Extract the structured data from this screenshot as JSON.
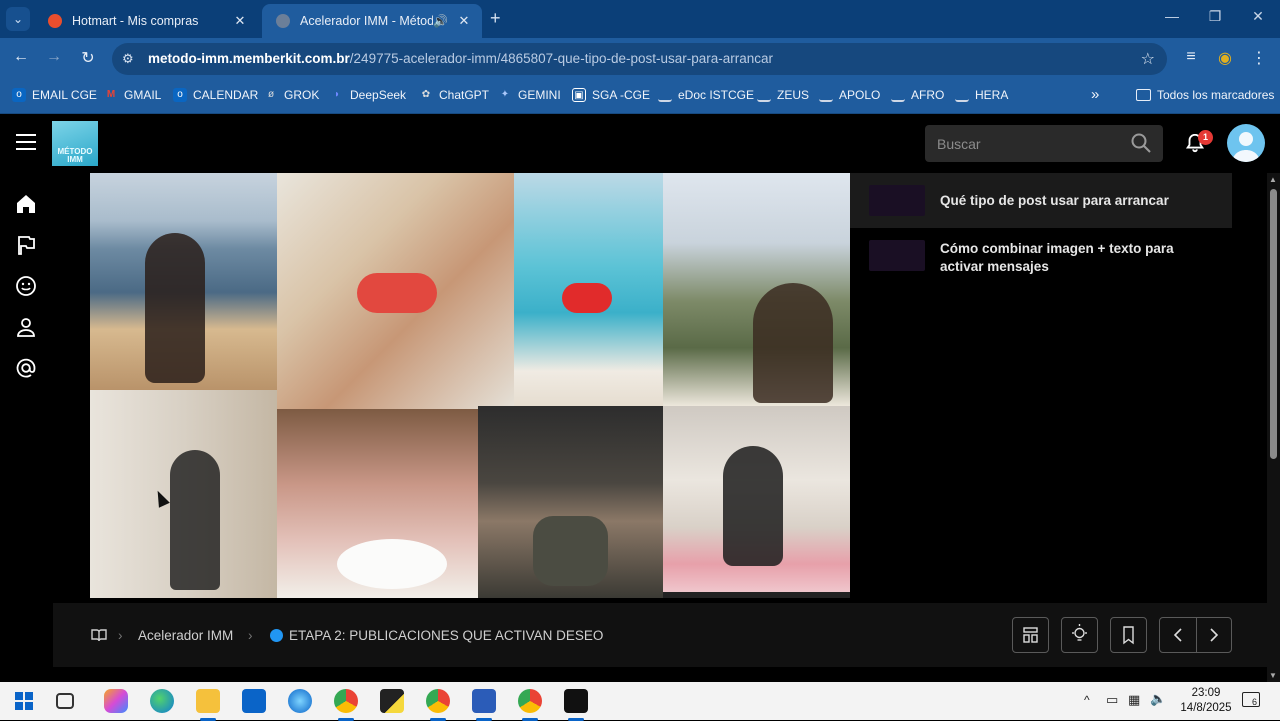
{
  "browser": {
    "tabs": [
      {
        "title": "Hotmart - Mis compras",
        "close": "✕"
      },
      {
        "title": "Acelerador IMM - Método IMM",
        "close": "✕"
      }
    ],
    "new_tab": "+",
    "url_domain": "metodo-imm.memberkit.com.br",
    "url_path": "/249775-acelerador-imm/4865807-que-tipo-de-post-usar-para-arrancar"
  },
  "bookmarks": {
    "items": [
      {
        "label": "EMAIL CGE",
        "color": "#0a66c2"
      },
      {
        "label": "GMAIL",
        "color": "#ea4335"
      },
      {
        "label": "CALENDAR",
        "color": "#0a66c2"
      },
      {
        "label": "GROK",
        "color": "#cccccc"
      },
      {
        "label": "DeepSeek",
        "color": "#4d6bfe"
      },
      {
        "label": "ChatGPT",
        "color": "#cccccc"
      },
      {
        "label": "GEMINI",
        "color": "#8ab4f8"
      },
      {
        "label": "SGA -CGE",
        "color": "#ffffff"
      },
      {
        "label": "eDoc ISTCGE",
        "color": "#1e3a6e"
      },
      {
        "label": "ZEUS",
        "color": "#1e3a6e"
      },
      {
        "label": "APOLO",
        "color": "#1e3a6e"
      },
      {
        "label": "AFRO",
        "color": "#1e3a6e"
      },
      {
        "label": "HERA",
        "color": "#1e3a6e"
      }
    ],
    "overflow": "»",
    "all_bookmarks": "Todos los marcadores"
  },
  "app": {
    "logo_text": "MÉTODO IMM",
    "search_placeholder": "Buscar",
    "notification_count": "1"
  },
  "lessons": [
    {
      "title": "Qué tipo de post usar para arrancar"
    },
    {
      "title": "Cómo combinar imagen + texto para activar mensajes"
    }
  ],
  "breadcrumb": {
    "course": "Acelerador IMM",
    "section": "ETAPA 2: PUBLICACIONES QUE ACTIVAN DESEO"
  },
  "taskbar": {
    "time": "23:09",
    "date": "14/8/2025",
    "notifications": "6"
  },
  "colors": {
    "chrome_tabstrip": "#0b3f78",
    "chrome_toolbar": "#1f5c9e",
    "accent_blue": "#2196f3",
    "badge_red": "#e53935"
  }
}
